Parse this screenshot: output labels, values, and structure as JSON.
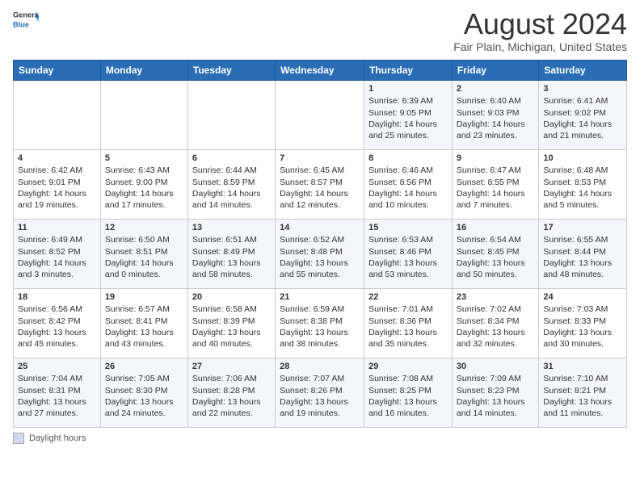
{
  "logo": {
    "general": "General",
    "blue": "Blue"
  },
  "title": "August 2024",
  "location": "Fair Plain, Michigan, United States",
  "days_of_week": [
    "Sunday",
    "Monday",
    "Tuesday",
    "Wednesday",
    "Thursday",
    "Friday",
    "Saturday"
  ],
  "footer_label": "Daylight hours",
  "weeks": [
    [
      {
        "num": "",
        "lines": []
      },
      {
        "num": "",
        "lines": []
      },
      {
        "num": "",
        "lines": []
      },
      {
        "num": "",
        "lines": []
      },
      {
        "num": "1",
        "lines": [
          "Sunrise: 6:39 AM",
          "Sunset: 9:05 PM",
          "Daylight: 14 hours",
          "and 25 minutes."
        ]
      },
      {
        "num": "2",
        "lines": [
          "Sunrise: 6:40 AM",
          "Sunset: 9:03 PM",
          "Daylight: 14 hours",
          "and 23 minutes."
        ]
      },
      {
        "num": "3",
        "lines": [
          "Sunrise: 6:41 AM",
          "Sunset: 9:02 PM",
          "Daylight: 14 hours",
          "and 21 minutes."
        ]
      }
    ],
    [
      {
        "num": "4",
        "lines": [
          "Sunrise: 6:42 AM",
          "Sunset: 9:01 PM",
          "Daylight: 14 hours",
          "and 19 minutes."
        ]
      },
      {
        "num": "5",
        "lines": [
          "Sunrise: 6:43 AM",
          "Sunset: 9:00 PM",
          "Daylight: 14 hours",
          "and 17 minutes."
        ]
      },
      {
        "num": "6",
        "lines": [
          "Sunrise: 6:44 AM",
          "Sunset: 8:59 PM",
          "Daylight: 14 hours",
          "and 14 minutes."
        ]
      },
      {
        "num": "7",
        "lines": [
          "Sunrise: 6:45 AM",
          "Sunset: 8:57 PM",
          "Daylight: 14 hours",
          "and 12 minutes."
        ]
      },
      {
        "num": "8",
        "lines": [
          "Sunrise: 6:46 AM",
          "Sunset: 8:56 PM",
          "Daylight: 14 hours",
          "and 10 minutes."
        ]
      },
      {
        "num": "9",
        "lines": [
          "Sunrise: 6:47 AM",
          "Sunset: 8:55 PM",
          "Daylight: 14 hours",
          "and 7 minutes."
        ]
      },
      {
        "num": "10",
        "lines": [
          "Sunrise: 6:48 AM",
          "Sunset: 8:53 PM",
          "Daylight: 14 hours",
          "and 5 minutes."
        ]
      }
    ],
    [
      {
        "num": "11",
        "lines": [
          "Sunrise: 6:49 AM",
          "Sunset: 8:52 PM",
          "Daylight: 14 hours",
          "and 3 minutes."
        ]
      },
      {
        "num": "12",
        "lines": [
          "Sunrise: 6:50 AM",
          "Sunset: 8:51 PM",
          "Daylight: 14 hours",
          "and 0 minutes."
        ]
      },
      {
        "num": "13",
        "lines": [
          "Sunrise: 6:51 AM",
          "Sunset: 8:49 PM",
          "Daylight: 13 hours",
          "and 58 minutes."
        ]
      },
      {
        "num": "14",
        "lines": [
          "Sunrise: 6:52 AM",
          "Sunset: 8:48 PM",
          "Daylight: 13 hours",
          "and 55 minutes."
        ]
      },
      {
        "num": "15",
        "lines": [
          "Sunrise: 6:53 AM",
          "Sunset: 8:46 PM",
          "Daylight: 13 hours",
          "and 53 minutes."
        ]
      },
      {
        "num": "16",
        "lines": [
          "Sunrise: 6:54 AM",
          "Sunset: 8:45 PM",
          "Daylight: 13 hours",
          "and 50 minutes."
        ]
      },
      {
        "num": "17",
        "lines": [
          "Sunrise: 6:55 AM",
          "Sunset: 8:44 PM",
          "Daylight: 13 hours",
          "and 48 minutes."
        ]
      }
    ],
    [
      {
        "num": "18",
        "lines": [
          "Sunrise: 6:56 AM",
          "Sunset: 8:42 PM",
          "Daylight: 13 hours",
          "and 45 minutes."
        ]
      },
      {
        "num": "19",
        "lines": [
          "Sunrise: 6:57 AM",
          "Sunset: 8:41 PM",
          "Daylight: 13 hours",
          "and 43 minutes."
        ]
      },
      {
        "num": "20",
        "lines": [
          "Sunrise: 6:58 AM",
          "Sunset: 8:39 PM",
          "Daylight: 13 hours",
          "and 40 minutes."
        ]
      },
      {
        "num": "21",
        "lines": [
          "Sunrise: 6:59 AM",
          "Sunset: 8:38 PM",
          "Daylight: 13 hours",
          "and 38 minutes."
        ]
      },
      {
        "num": "22",
        "lines": [
          "Sunrise: 7:01 AM",
          "Sunset: 8:36 PM",
          "Daylight: 13 hours",
          "and 35 minutes."
        ]
      },
      {
        "num": "23",
        "lines": [
          "Sunrise: 7:02 AM",
          "Sunset: 8:34 PM",
          "Daylight: 13 hours",
          "and 32 minutes."
        ]
      },
      {
        "num": "24",
        "lines": [
          "Sunrise: 7:03 AM",
          "Sunset: 8:33 PM",
          "Daylight: 13 hours",
          "and 30 minutes."
        ]
      }
    ],
    [
      {
        "num": "25",
        "lines": [
          "Sunrise: 7:04 AM",
          "Sunset: 8:31 PM",
          "Daylight: 13 hours",
          "and 27 minutes."
        ]
      },
      {
        "num": "26",
        "lines": [
          "Sunrise: 7:05 AM",
          "Sunset: 8:30 PM",
          "Daylight: 13 hours",
          "and 24 minutes."
        ]
      },
      {
        "num": "27",
        "lines": [
          "Sunrise: 7:06 AM",
          "Sunset: 8:28 PM",
          "Daylight: 13 hours",
          "and 22 minutes."
        ]
      },
      {
        "num": "28",
        "lines": [
          "Sunrise: 7:07 AM",
          "Sunset: 8:26 PM",
          "Daylight: 13 hours",
          "and 19 minutes."
        ]
      },
      {
        "num": "29",
        "lines": [
          "Sunrise: 7:08 AM",
          "Sunset: 8:25 PM",
          "Daylight: 13 hours",
          "and 16 minutes."
        ]
      },
      {
        "num": "30",
        "lines": [
          "Sunrise: 7:09 AM",
          "Sunset: 8:23 PM",
          "Daylight: 13 hours",
          "and 14 minutes."
        ]
      },
      {
        "num": "31",
        "lines": [
          "Sunrise: 7:10 AM",
          "Sunset: 8:21 PM",
          "Daylight: 13 hours",
          "and 11 minutes."
        ]
      }
    ]
  ]
}
